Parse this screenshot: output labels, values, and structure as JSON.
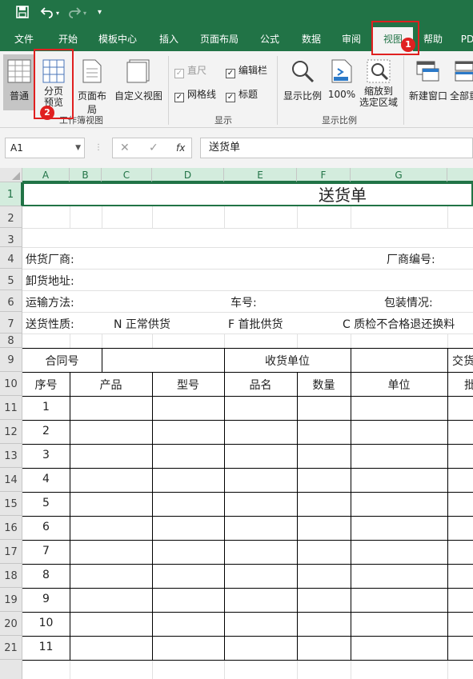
{
  "qat": {
    "save_icon": "save-icon",
    "undo_icon": "undo-icon",
    "redo_icon": "redo-icon",
    "customize_icon": "customize-icon"
  },
  "tabs": [
    "文件",
    "开始",
    "模板中心",
    "插入",
    "页面布局",
    "公式",
    "数据",
    "审阅",
    "视图",
    "帮助",
    "PD"
  ],
  "active_tab": "视图",
  "badges": {
    "first": "1",
    "second": "2"
  },
  "ribbon": {
    "normal": "普通",
    "page_break_l1": "分页",
    "page_break_l2": "预览",
    "page_layout": "页面布局",
    "custom_view": "自定义视图",
    "group_workbook_views": "工作簿视图",
    "ruler": "直尺",
    "formula_bar": "编辑栏",
    "gridlines": "网格线",
    "headings": "标题",
    "group_show": "显示",
    "zoom": "显示比例",
    "zoom100": "100%",
    "zoom_sel_l1": "缩放到",
    "zoom_sel_l2": "选定区域",
    "group_zoom": "显示比例",
    "new_window": "新建窗口",
    "arrange_all": "全部重"
  },
  "formula_bar": {
    "name_box": "A1",
    "fx": "fx",
    "cancel": "✕",
    "confirm": "✓",
    "content": "送货单"
  },
  "columns": [
    "A",
    "B",
    "C",
    "D",
    "E",
    "F",
    "G"
  ],
  "rows": [
    "1",
    "2",
    "3",
    "4",
    "5",
    "6",
    "7",
    "8",
    "9",
    "10",
    "11",
    "12",
    "13",
    "14",
    "15",
    "16",
    "17",
    "18",
    "19",
    "20",
    "21"
  ],
  "sheet": {
    "title": "送货单",
    "supplier": "供货厂商:",
    "vendor_no": "厂商编号:",
    "unload_addr": "卸货地址:",
    "transport": "运输方法:",
    "car_no": "车号:",
    "packing": "包装情况:",
    "delivery_type": "送货性质:",
    "opt_n": "N 正常供货",
    "opt_f": "F  首批供货",
    "opt_c": "C  质检不合格退还换料",
    "contract_no": "合同号",
    "receiver": "收货单位",
    "trade": "交货",
    "h_seq": "序号",
    "h_product": "产品",
    "h_model": "型号",
    "h_name": "品名",
    "h_qty": "数量",
    "h_unit": "单位",
    "h_batch": "批",
    "seq": [
      "1",
      "2",
      "3",
      "4",
      "5",
      "6",
      "7",
      "8",
      "9",
      "10",
      "11"
    ]
  }
}
